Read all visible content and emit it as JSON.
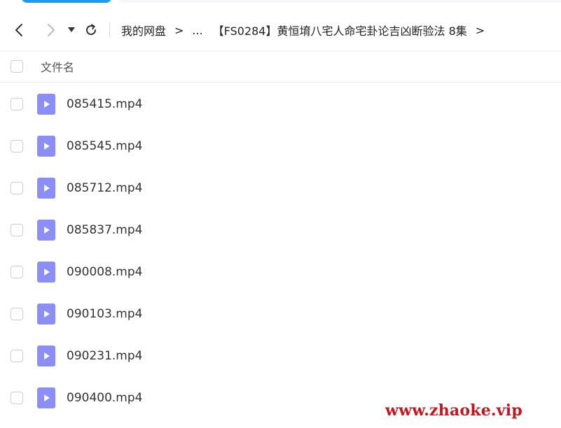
{
  "toolbar": {
    "back_icon": "chevron-left-icon",
    "forward_icon": "chevron-right-icon",
    "dropdown_icon": "caret-down-icon",
    "refresh_icon": "refresh-icon"
  },
  "breadcrumb": {
    "root": "我的网盘",
    "separator": ">",
    "ellipsis": "...",
    "current": "【FS0284】黄恒堉八宅人命宅卦论吉凶断验法 8集"
  },
  "file_table": {
    "column_name": "文件名",
    "files": [
      {
        "name": "085415.mp4"
      },
      {
        "name": "085545.mp4"
      },
      {
        "name": "085712.mp4"
      },
      {
        "name": "085837.mp4"
      },
      {
        "name": "090008.mp4"
      },
      {
        "name": "090103.mp4"
      },
      {
        "name": "090231.mp4"
      },
      {
        "name": "090400.mp4"
      }
    ]
  },
  "watermark": "www.zhaoke.vip",
  "colors": {
    "video_icon": "#8b8ff5",
    "watermark": "#c5161d",
    "accent": "#1a9bf0"
  }
}
